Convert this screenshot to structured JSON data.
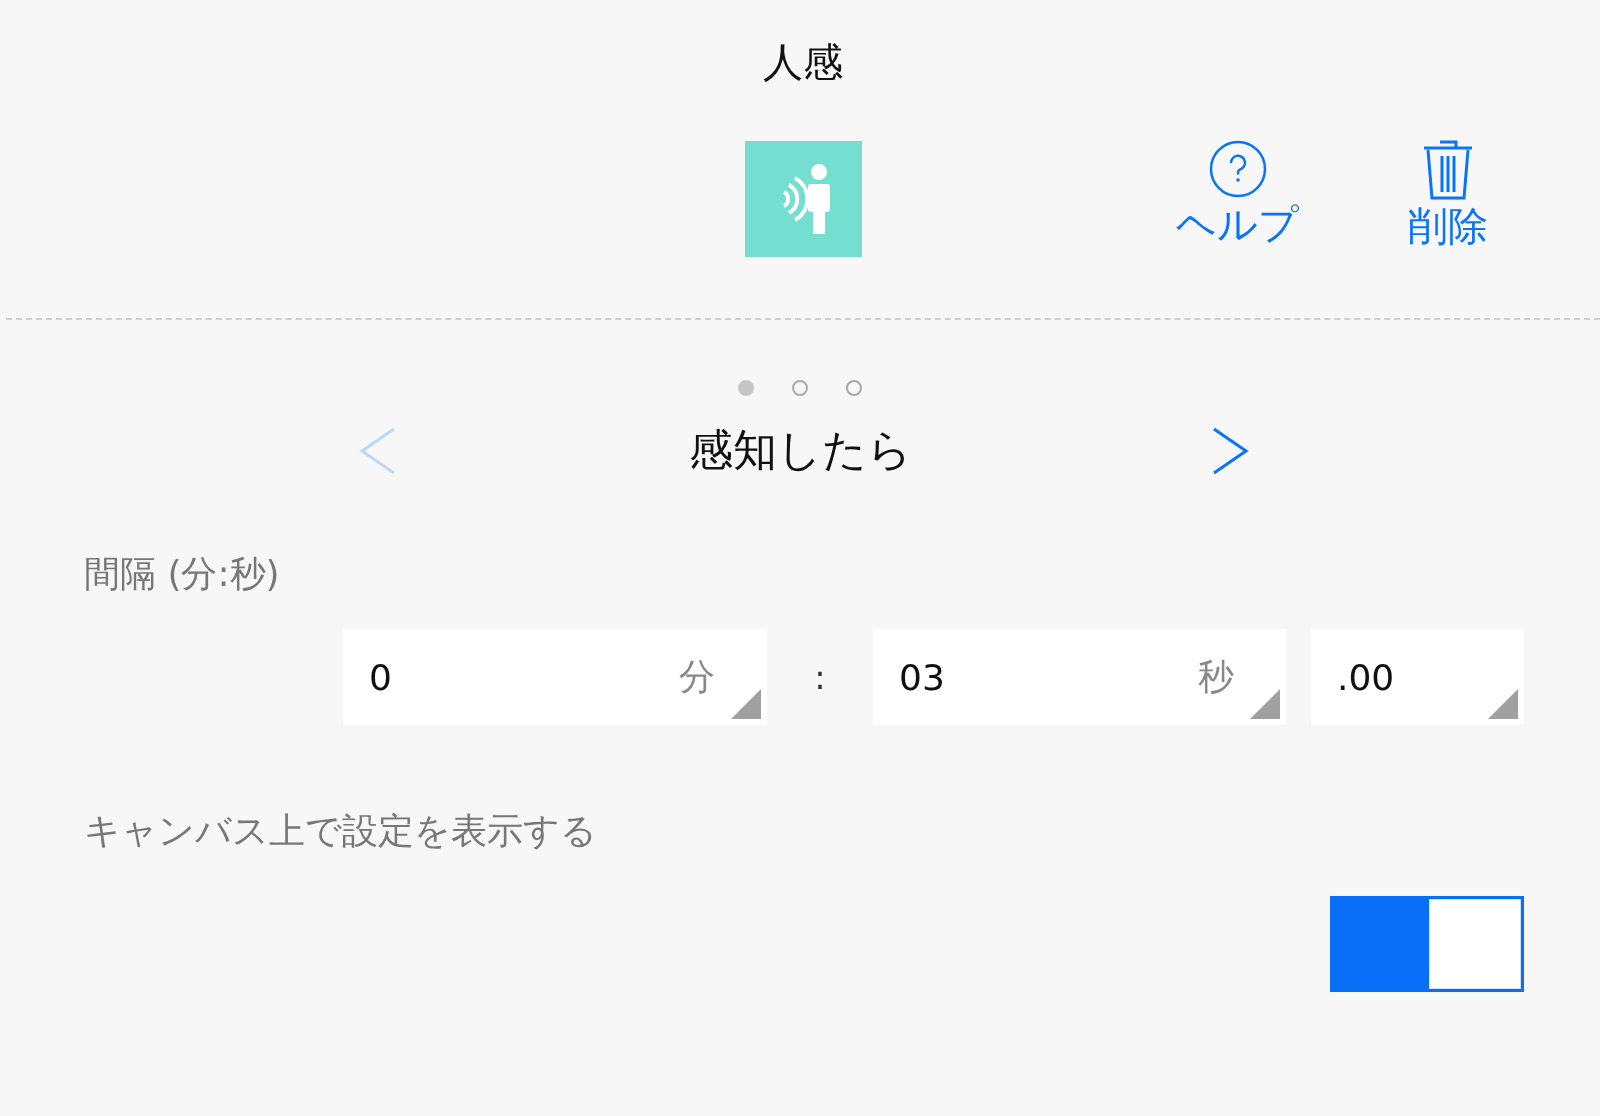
{
  "header": {
    "title": "人感",
    "actions": [
      {
        "kind": "help",
        "label": "ヘルプ"
      },
      {
        "kind": "delete",
        "label": "削除"
      }
    ]
  },
  "pager": {
    "dots": [
      {
        "selected": true
      },
      {
        "selected": false
      },
      {
        "selected": false
      }
    ],
    "title": "感知したら",
    "prev": {
      "disabled": true
    },
    "next": {
      "disabled": false
    }
  },
  "interval": {
    "label": "間隔 (分:秒)",
    "separator": ":",
    "fields": [
      {
        "value": "0",
        "unit": "分"
      },
      {
        "value": "03",
        "unit": "秒"
      },
      {
        "value": ".00"
      }
    ]
  },
  "canvas_setting": {
    "label": "キャンバス上で設定を表示する",
    "on": true
  }
}
